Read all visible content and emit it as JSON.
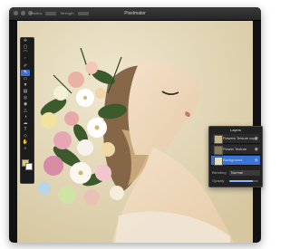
{
  "window": {
    "title": "Pixelmator",
    "options": [
      "Radius",
      "Strength"
    ]
  },
  "tools": [
    {
      "icon": "move-icon",
      "glyph": "✛",
      "active": false
    },
    {
      "icon": "select-icon",
      "glyph": "▢",
      "active": false
    },
    {
      "icon": "lasso-icon",
      "glyph": "⌒",
      "active": false
    },
    {
      "icon": "crop-icon",
      "glyph": "⌜",
      "active": false
    },
    {
      "icon": "eyedropper-icon",
      "glyph": "✐",
      "active": false
    },
    {
      "icon": "brush-icon",
      "glyph": "✎",
      "active": true
    },
    {
      "icon": "eraser-icon",
      "glyph": "▭",
      "active": false
    },
    {
      "icon": "bucket-icon",
      "glyph": "▼",
      "active": false
    },
    {
      "icon": "gradient-icon",
      "glyph": "▤",
      "active": false
    },
    {
      "icon": "clone-icon",
      "glyph": "◎",
      "active": false
    },
    {
      "icon": "blur-icon",
      "glyph": "◉",
      "active": false
    },
    {
      "icon": "sharpen-icon",
      "glyph": "△",
      "active": false
    },
    {
      "icon": "dodge-icon",
      "glyph": "◑",
      "active": false
    },
    {
      "icon": "sponge-icon",
      "glyph": "☁",
      "active": false
    },
    {
      "icon": "text-icon",
      "glyph": "T",
      "active": false
    },
    {
      "icon": "shape-icon",
      "glyph": "◇",
      "active": false
    },
    {
      "icon": "hand-icon",
      "glyph": "✋",
      "active": false
    },
    {
      "icon": "zoom-icon",
      "glyph": "⌕",
      "active": false
    }
  ],
  "colors": {
    "foreground": "#e8cf3a",
    "background": "#ffffff",
    "accent": "#3a74d6"
  },
  "layers_panel": {
    "title": "Layers",
    "items": [
      {
        "name": "Flowers Texture copy",
        "selected": false,
        "thumb": "#c9b48a"
      },
      {
        "name": "Flower Texture",
        "selected": false,
        "thumb": "#8a7a60"
      },
      {
        "name": "Background",
        "selected": true,
        "thumb": "#e6dcc0"
      }
    ],
    "blend_label": "Blending",
    "blend_value": "Normal",
    "opacity_label": "Opacity",
    "opacity": 0.8
  }
}
